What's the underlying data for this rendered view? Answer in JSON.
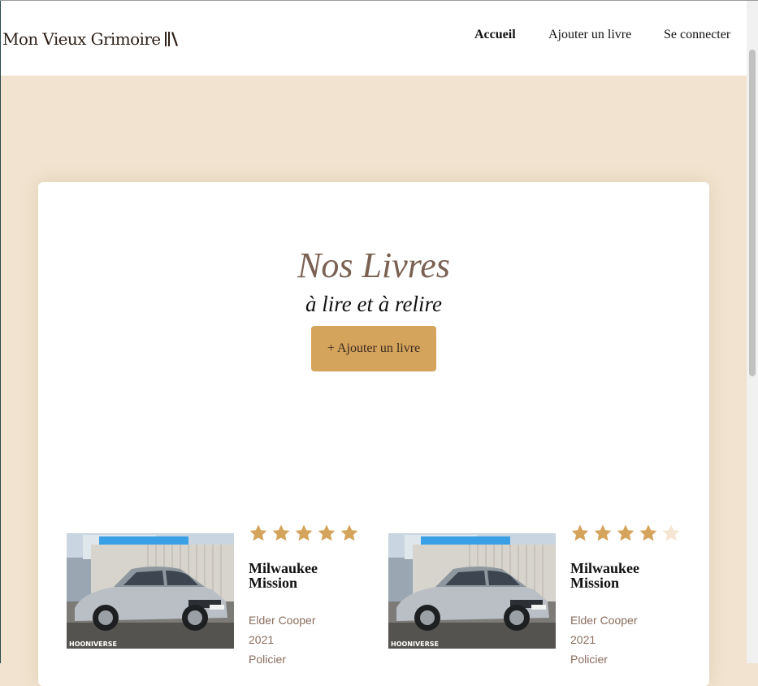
{
  "header": {
    "logo_text": "Mon Vieux Grimoire",
    "nav": [
      {
        "label": "Accueil",
        "active": true
      },
      {
        "label": "Ajouter un livre",
        "active": false
      },
      {
        "label": "Se connecter",
        "active": false
      }
    ]
  },
  "main": {
    "title": "Nos Livres",
    "subtitle": "à lire et à relire",
    "add_button": "+ Ajouter un livre"
  },
  "books": [
    {
      "title": "Milwaukee Mission",
      "author": "Elder Cooper",
      "year": "2021",
      "genre": "Policier",
      "rating": 5,
      "cover_watermark": "HOONIVERSE"
    },
    {
      "title": "Milwaukee Mission",
      "author": "Elder Cooper",
      "year": "2021",
      "genre": "Policier",
      "rating": 4,
      "cover_watermark": "HOONIVERSE"
    }
  ],
  "colors": {
    "page_bg": "#f1e3cf",
    "accent": "#d5a45c",
    "star_on": "#d5a45c",
    "star_off": "#f4e6d2",
    "title_brown": "#7a6153"
  }
}
